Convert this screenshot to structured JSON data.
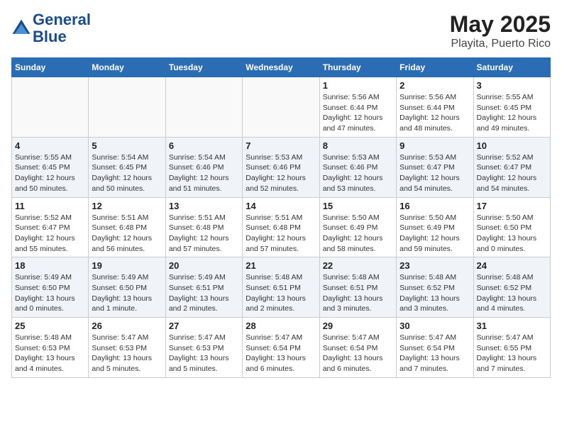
{
  "header": {
    "logo_line1": "General",
    "logo_line2": "Blue",
    "month": "May 2025",
    "location": "Playita, Puerto Rico"
  },
  "weekdays": [
    "Sunday",
    "Monday",
    "Tuesday",
    "Wednesday",
    "Thursday",
    "Friday",
    "Saturday"
  ],
  "weeks": [
    [
      {
        "day": "",
        "info": ""
      },
      {
        "day": "",
        "info": ""
      },
      {
        "day": "",
        "info": ""
      },
      {
        "day": "",
        "info": ""
      },
      {
        "day": "1",
        "info": "Sunrise: 5:56 AM\nSunset: 6:44 PM\nDaylight: 12 hours\nand 47 minutes."
      },
      {
        "day": "2",
        "info": "Sunrise: 5:56 AM\nSunset: 6:44 PM\nDaylight: 12 hours\nand 48 minutes."
      },
      {
        "day": "3",
        "info": "Sunrise: 5:55 AM\nSunset: 6:45 PM\nDaylight: 12 hours\nand 49 minutes."
      }
    ],
    [
      {
        "day": "4",
        "info": "Sunrise: 5:55 AM\nSunset: 6:45 PM\nDaylight: 12 hours\nand 50 minutes."
      },
      {
        "day": "5",
        "info": "Sunrise: 5:54 AM\nSunset: 6:45 PM\nDaylight: 12 hours\nand 50 minutes."
      },
      {
        "day": "6",
        "info": "Sunrise: 5:54 AM\nSunset: 6:46 PM\nDaylight: 12 hours\nand 51 minutes."
      },
      {
        "day": "7",
        "info": "Sunrise: 5:53 AM\nSunset: 6:46 PM\nDaylight: 12 hours\nand 52 minutes."
      },
      {
        "day": "8",
        "info": "Sunrise: 5:53 AM\nSunset: 6:46 PM\nDaylight: 12 hours\nand 53 minutes."
      },
      {
        "day": "9",
        "info": "Sunrise: 5:53 AM\nSunset: 6:47 PM\nDaylight: 12 hours\nand 54 minutes."
      },
      {
        "day": "10",
        "info": "Sunrise: 5:52 AM\nSunset: 6:47 PM\nDaylight: 12 hours\nand 54 minutes."
      }
    ],
    [
      {
        "day": "11",
        "info": "Sunrise: 5:52 AM\nSunset: 6:47 PM\nDaylight: 12 hours\nand 55 minutes."
      },
      {
        "day": "12",
        "info": "Sunrise: 5:51 AM\nSunset: 6:48 PM\nDaylight: 12 hours\nand 56 minutes."
      },
      {
        "day": "13",
        "info": "Sunrise: 5:51 AM\nSunset: 6:48 PM\nDaylight: 12 hours\nand 57 minutes."
      },
      {
        "day": "14",
        "info": "Sunrise: 5:51 AM\nSunset: 6:48 PM\nDaylight: 12 hours\nand 57 minutes."
      },
      {
        "day": "15",
        "info": "Sunrise: 5:50 AM\nSunset: 6:49 PM\nDaylight: 12 hours\nand 58 minutes."
      },
      {
        "day": "16",
        "info": "Sunrise: 5:50 AM\nSunset: 6:49 PM\nDaylight: 12 hours\nand 59 minutes."
      },
      {
        "day": "17",
        "info": "Sunrise: 5:50 AM\nSunset: 6:50 PM\nDaylight: 13 hours\nand 0 minutes."
      }
    ],
    [
      {
        "day": "18",
        "info": "Sunrise: 5:49 AM\nSunset: 6:50 PM\nDaylight: 13 hours\nand 0 minutes."
      },
      {
        "day": "19",
        "info": "Sunrise: 5:49 AM\nSunset: 6:50 PM\nDaylight: 13 hours\nand 1 minute."
      },
      {
        "day": "20",
        "info": "Sunrise: 5:49 AM\nSunset: 6:51 PM\nDaylight: 13 hours\nand 2 minutes."
      },
      {
        "day": "21",
        "info": "Sunrise: 5:48 AM\nSunset: 6:51 PM\nDaylight: 13 hours\nand 2 minutes."
      },
      {
        "day": "22",
        "info": "Sunrise: 5:48 AM\nSunset: 6:51 PM\nDaylight: 13 hours\nand 3 minutes."
      },
      {
        "day": "23",
        "info": "Sunrise: 5:48 AM\nSunset: 6:52 PM\nDaylight: 13 hours\nand 3 minutes."
      },
      {
        "day": "24",
        "info": "Sunrise: 5:48 AM\nSunset: 6:52 PM\nDaylight: 13 hours\nand 4 minutes."
      }
    ],
    [
      {
        "day": "25",
        "info": "Sunrise: 5:48 AM\nSunset: 6:53 PM\nDaylight: 13 hours\nand 4 minutes."
      },
      {
        "day": "26",
        "info": "Sunrise: 5:47 AM\nSunset: 6:53 PM\nDaylight: 13 hours\nand 5 minutes."
      },
      {
        "day": "27",
        "info": "Sunrise: 5:47 AM\nSunset: 6:53 PM\nDaylight: 13 hours\nand 5 minutes."
      },
      {
        "day": "28",
        "info": "Sunrise: 5:47 AM\nSunset: 6:54 PM\nDaylight: 13 hours\nand 6 minutes."
      },
      {
        "day": "29",
        "info": "Sunrise: 5:47 AM\nSunset: 6:54 PM\nDaylight: 13 hours\nand 6 minutes."
      },
      {
        "day": "30",
        "info": "Sunrise: 5:47 AM\nSunset: 6:54 PM\nDaylight: 13 hours\nand 7 minutes."
      },
      {
        "day": "31",
        "info": "Sunrise: 5:47 AM\nSunset: 6:55 PM\nDaylight: 13 hours\nand 7 minutes."
      }
    ]
  ]
}
